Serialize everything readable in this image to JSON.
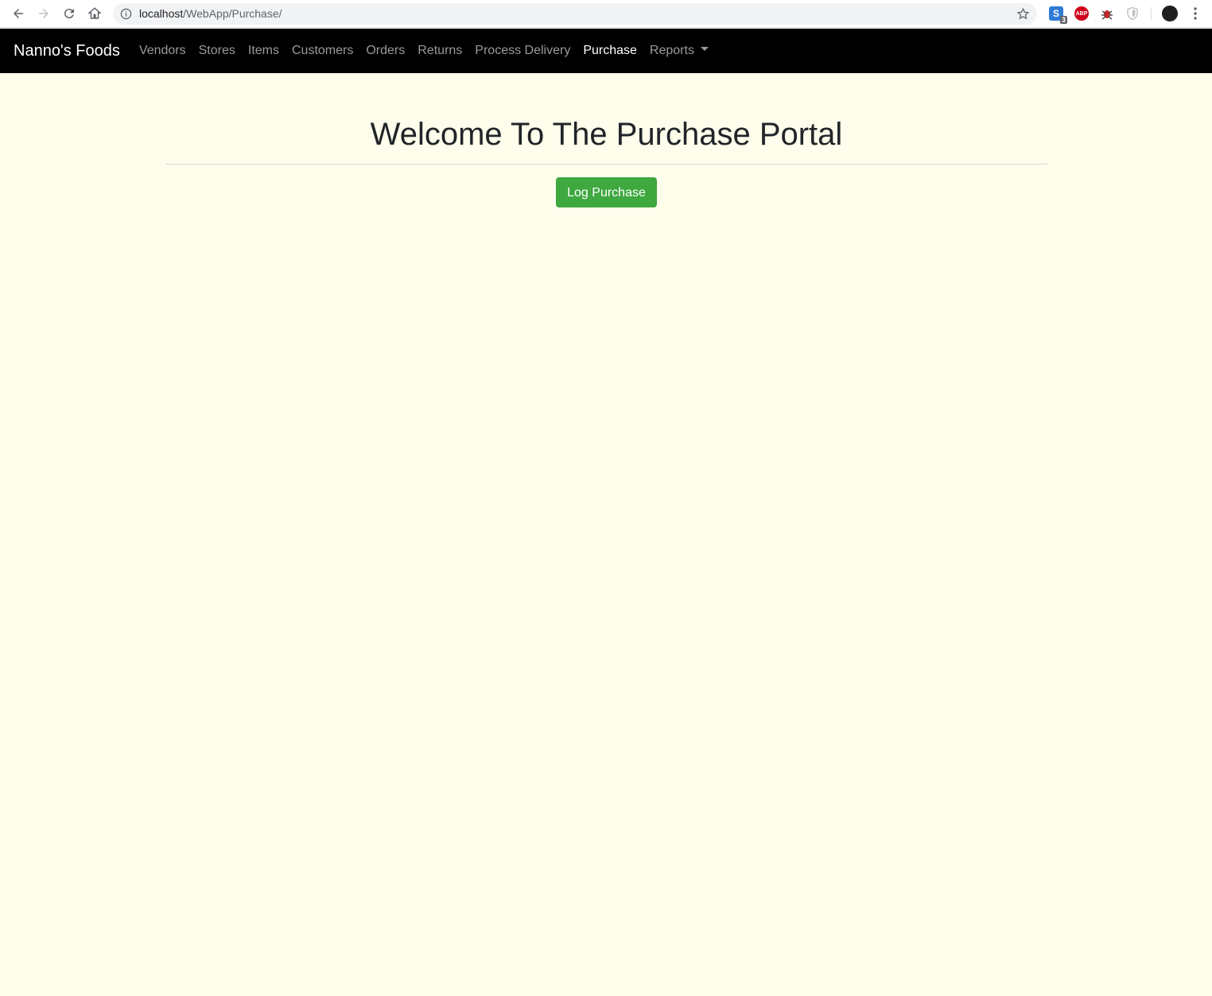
{
  "browser": {
    "url_host": "localhost",
    "url_path": "/WebApp/Purchase/",
    "extension_badge": "3",
    "abp_label": "ABP",
    "s_label": "S"
  },
  "navbar": {
    "brand": "Nanno's Foods",
    "links": [
      {
        "label": "Vendors"
      },
      {
        "label": "Stores"
      },
      {
        "label": "Items"
      },
      {
        "label": "Customers"
      },
      {
        "label": "Orders"
      },
      {
        "label": "Returns"
      },
      {
        "label": "Process Delivery"
      },
      {
        "label": "Purchase",
        "active": true
      },
      {
        "label": "Reports",
        "dropdown": true
      }
    ]
  },
  "main": {
    "title": "Welcome To The Purchase Portal",
    "log_purchase_label": "Log Purchase"
  },
  "colors": {
    "page_background": "#fffdeb",
    "navbar_background": "#000000",
    "button_green": "#3fa83f"
  }
}
